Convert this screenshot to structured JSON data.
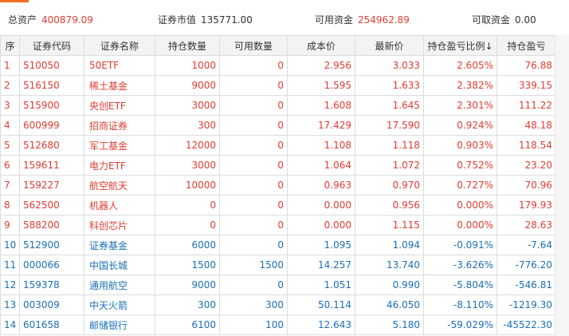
{
  "summary": {
    "total_assets_label": "总资产",
    "total_assets_value": "400879.09",
    "market_value_label": "证券市值",
    "market_value_value": "135771.00",
    "available_funds_label": "可用资金",
    "available_funds_value": "254962.89",
    "withdrawable_label": "可取资金",
    "withdrawable_value": "0.00"
  },
  "colors": {
    "gain": "#e03c31",
    "loss": "#1a6fb8",
    "accent": "#f07020"
  },
  "table": {
    "columns": [
      "序",
      "证券代码",
      "证券名称",
      "持仓数量",
      "可用数量",
      "成本价",
      "最新价",
      "持仓盈亏比例↓",
      "持仓盈亏"
    ],
    "rows": [
      {
        "idx": "1",
        "code": "510050",
        "name": "50ETF",
        "qty": "1000",
        "avail": "0",
        "cost": "2.956",
        "price": "3.033",
        "pct": "2.605%",
        "pnl": "76.88",
        "trend": "gain"
      },
      {
        "idx": "2",
        "code": "516150",
        "name": "稀土基金",
        "qty": "9000",
        "avail": "0",
        "cost": "1.595",
        "price": "1.633",
        "pct": "2.382%",
        "pnl": "339.15",
        "trend": "gain"
      },
      {
        "idx": "3",
        "code": "515900",
        "name": "央创ETF",
        "qty": "3000",
        "avail": "0",
        "cost": "1.608",
        "price": "1.645",
        "pct": "2.301%",
        "pnl": "111.22",
        "trend": "gain"
      },
      {
        "idx": "4",
        "code": "600999",
        "name": "招商证券",
        "qty": "300",
        "avail": "0",
        "cost": "17.429",
        "price": "17.590",
        "pct": "0.924%",
        "pnl": "48.18",
        "trend": "gain"
      },
      {
        "idx": "5",
        "code": "512680",
        "name": "军工基金",
        "qty": "12000",
        "avail": "0",
        "cost": "1.108",
        "price": "1.118",
        "pct": "0.903%",
        "pnl": "118.54",
        "trend": "gain"
      },
      {
        "idx": "6",
        "code": "159611",
        "name": "电力ETF",
        "qty": "3000",
        "avail": "0",
        "cost": "1.064",
        "price": "1.072",
        "pct": "0.752%",
        "pnl": "23.20",
        "trend": "gain"
      },
      {
        "idx": "7",
        "code": "159227",
        "name": "航空航天",
        "qty": "10000",
        "avail": "0",
        "cost": "0.963",
        "price": "0.970",
        "pct": "0.727%",
        "pnl": "70.96",
        "trend": "gain"
      },
      {
        "idx": "8",
        "code": "562500",
        "name": "机器人",
        "qty": "0",
        "avail": "0",
        "cost": "0.000",
        "price": "0.956",
        "pct": "0.000%",
        "pnl": "179.93",
        "trend": "gain"
      },
      {
        "idx": "9",
        "code": "588200",
        "name": "科创芯片",
        "qty": "0",
        "avail": "0",
        "cost": "0.000",
        "price": "1.115",
        "pct": "0.000%",
        "pnl": "28.63",
        "trend": "gain"
      },
      {
        "idx": "10",
        "code": "512900",
        "name": "证券基金",
        "qty": "6000",
        "avail": "0",
        "cost": "1.095",
        "price": "1.094",
        "pct": "-0.091%",
        "pnl": "-7.64",
        "trend": "loss"
      },
      {
        "idx": "11",
        "code": "000066",
        "name": "中国长城",
        "qty": "1500",
        "avail": "1500",
        "cost": "14.257",
        "price": "13.740",
        "pct": "-3.626%",
        "pnl": "-776.20",
        "trend": "loss"
      },
      {
        "idx": "12",
        "code": "159378",
        "name": "通用航空",
        "qty": "9000",
        "avail": "0",
        "cost": "1.051",
        "price": "0.990",
        "pct": "-5.804%",
        "pnl": "-546.81",
        "trend": "loss"
      },
      {
        "idx": "13",
        "code": "003009",
        "name": "中天火箭",
        "qty": "300",
        "avail": "300",
        "cost": "50.114",
        "price": "46.050",
        "pct": "-8.110%",
        "pnl": "-1219.30",
        "trend": "loss"
      },
      {
        "idx": "14",
        "code": "601658",
        "name": "邮储银行",
        "qty": "6100",
        "avail": "100",
        "cost": "12.643",
        "price": "5.180",
        "pct": "-59.029%",
        "pnl": "-45522.30",
        "trend": "loss"
      }
    ]
  }
}
